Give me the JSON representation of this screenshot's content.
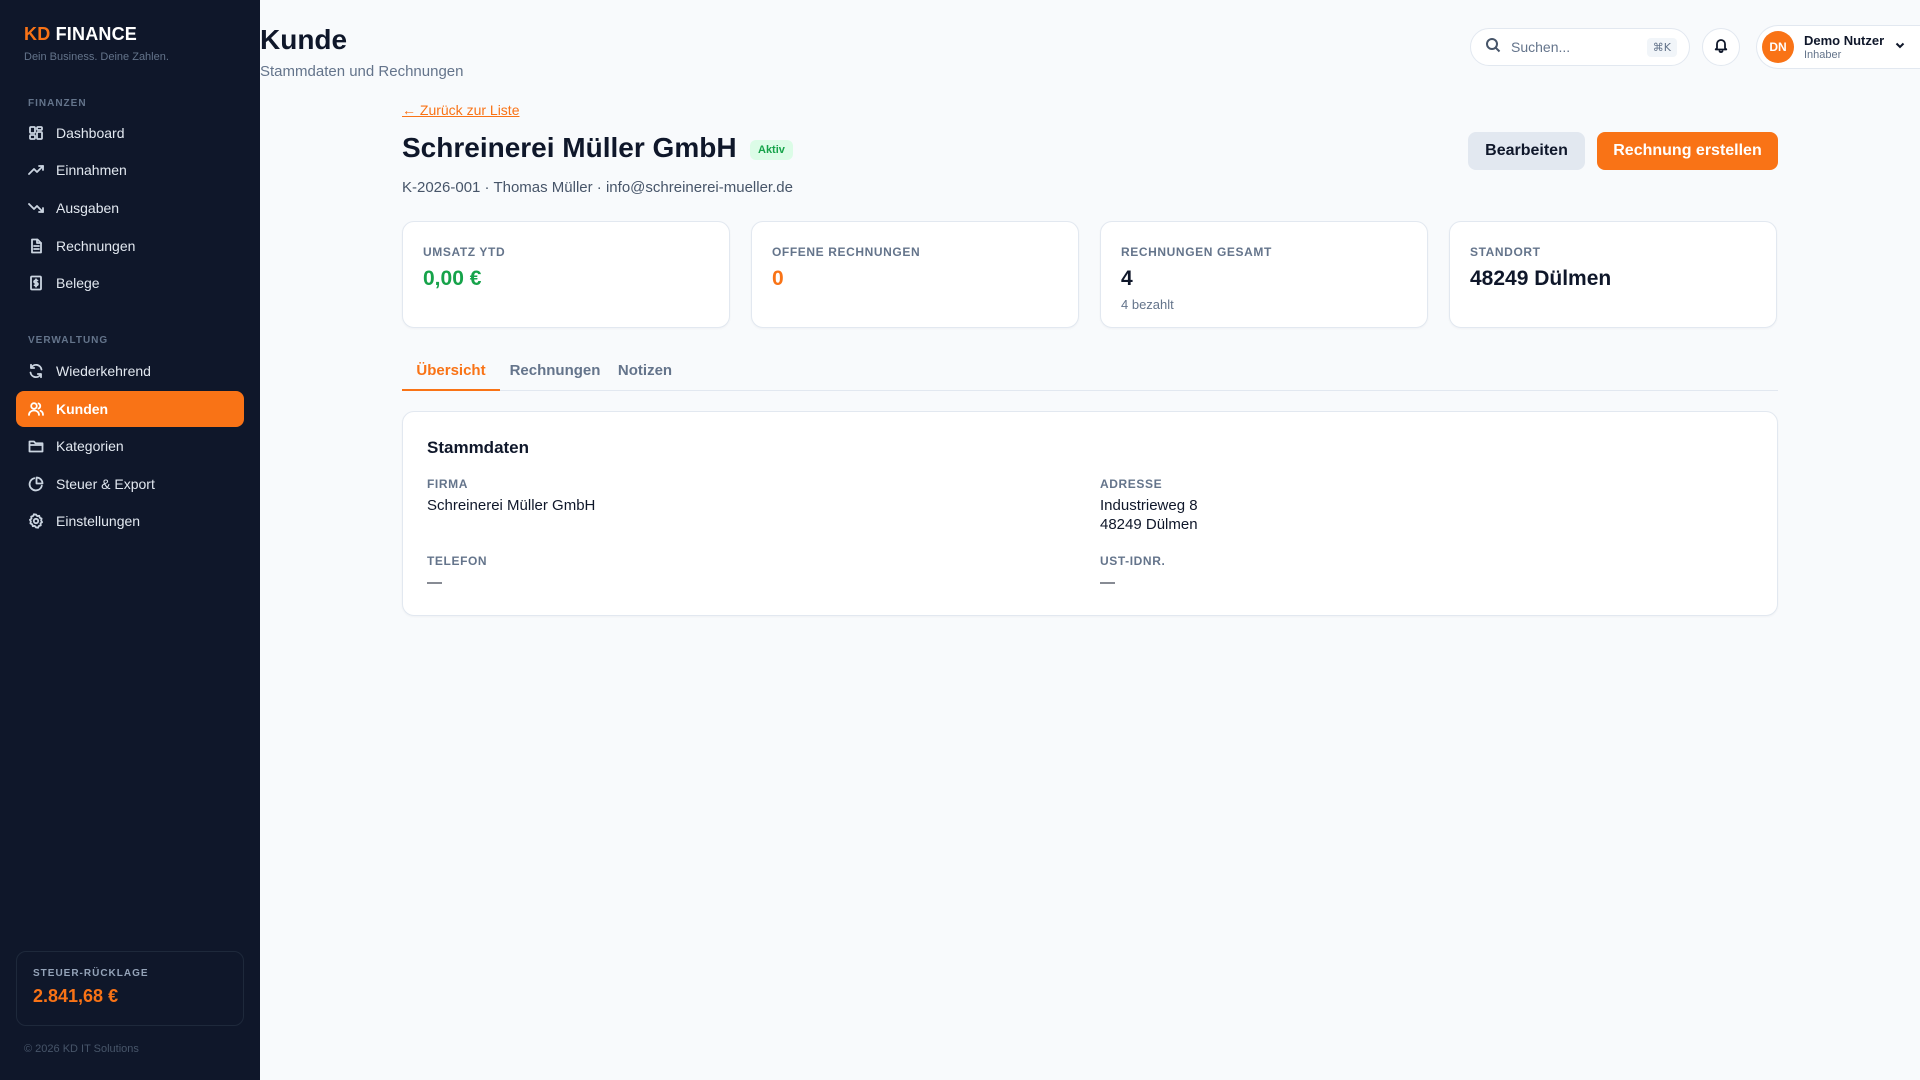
{
  "brand": {
    "prefix": "KD",
    "name": "FINANCE",
    "tagline": "Dein Business. Deine Zahlen."
  },
  "sidebar": {
    "section_finance": "FINANZEN",
    "section_admin": "VERWALTUNG",
    "items": [
      {
        "label": "Dashboard",
        "icon": "dashboard-icon"
      },
      {
        "label": "Einnahmen",
        "icon": "trending-up-icon"
      },
      {
        "label": "Ausgaben",
        "icon": "trending-down-icon"
      },
      {
        "label": "Rechnungen",
        "icon": "document-icon"
      },
      {
        "label": "Belege",
        "icon": "receipt-icon"
      },
      {
        "label": "Wiederkehrend",
        "icon": "refresh-icon"
      },
      {
        "label": "Kunden",
        "icon": "users-icon",
        "active": true
      },
      {
        "label": "Kategorien",
        "icon": "folder-icon"
      },
      {
        "label": "Steuer & Export",
        "icon": "pie-chart-icon"
      },
      {
        "label": "Einstellungen",
        "icon": "gear-icon"
      }
    ],
    "reserve": {
      "label": "STEUER-RÜCKLAGE",
      "value": "2.841,68 €"
    },
    "copyright": "© 2026 KD IT Solutions"
  },
  "header": {
    "title": "Kunde",
    "subtitle": "Stammdaten und Rechnungen",
    "search_placeholder": "Suchen...",
    "search_shortcut": "⌘K",
    "user": {
      "initials": "DN",
      "name": "Demo Nutzer",
      "role": "Inhaber"
    }
  },
  "customer": {
    "back_label": "← Zurück zur Liste",
    "name": "Schreinerei Müller GmbH",
    "status": "Aktiv",
    "meta": "K-2026-001 · Thomas Müller · info@schreinerei-mueller.de",
    "edit_label": "Bearbeiten",
    "create_invoice_label": "Rechnung erstellen"
  },
  "stats": [
    {
      "label": "UMSATZ YTD",
      "value": "0,00 €",
      "sub": ""
    },
    {
      "label": "OFFENE RECHNUNGEN",
      "value": "0",
      "sub": ""
    },
    {
      "label": "RECHNUNGEN GESAMT",
      "value": "4",
      "sub": "4 bezahlt"
    },
    {
      "label": "STANDORT",
      "value": "48249 Dülmen",
      "sub": ""
    }
  ],
  "tabs": [
    {
      "label": "Übersicht",
      "active": true
    },
    {
      "label": "Rechnungen"
    },
    {
      "label": "Notizen"
    }
  ],
  "master_data": {
    "title": "Stammdaten",
    "company_label": "FIRMA",
    "company_value": "Schreinerei Müller GmbH",
    "address_label": "ADRESSE",
    "address_line1": "Industrieweg 8",
    "address_line2": "48249 Dülmen",
    "phone_label": "TELEFON",
    "phone_value": "—",
    "vat_label": "UST-IDNR.",
    "vat_value": "—"
  },
  "colors": {
    "accent": "#f97316",
    "sidebar_bg": "#0f172a",
    "success": "#16a34a"
  }
}
